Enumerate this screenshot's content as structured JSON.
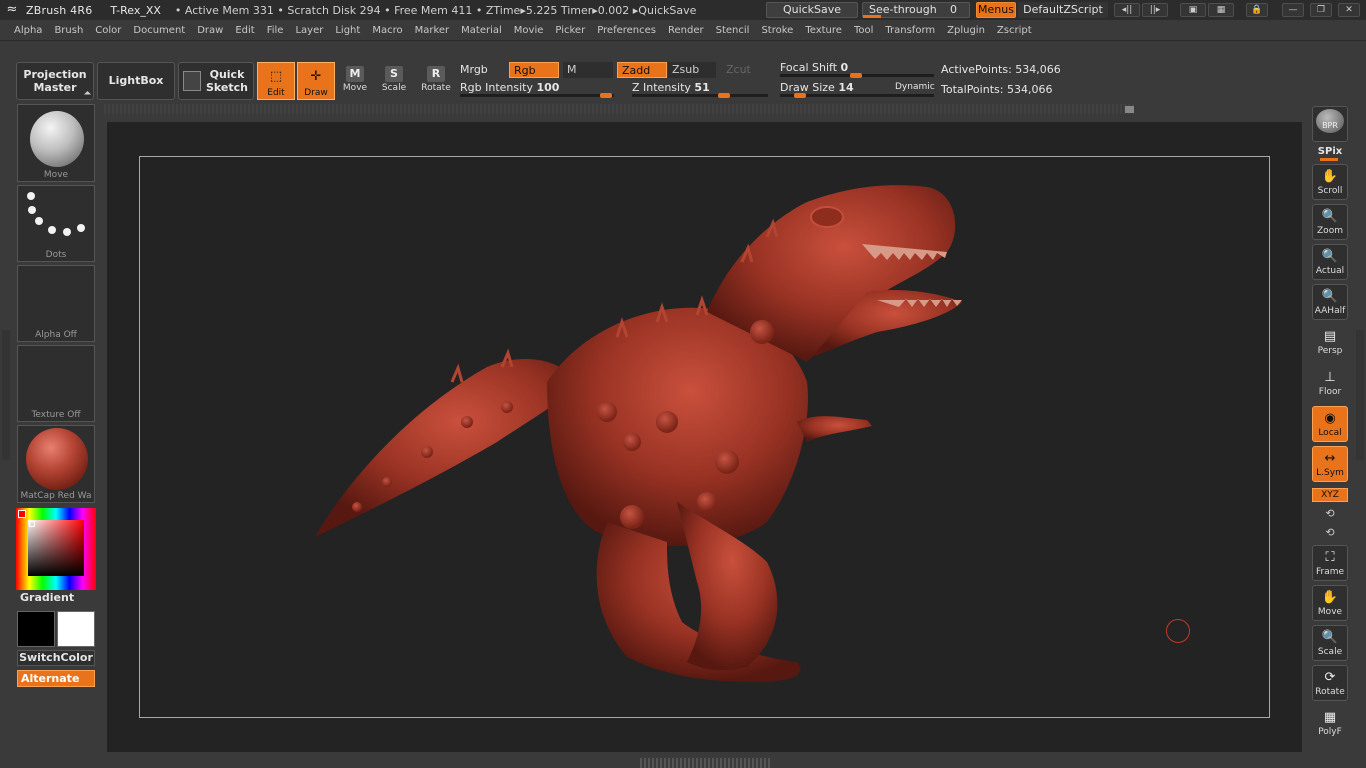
{
  "titlebar": {
    "app": "ZBrush 4R6",
    "file": "T-Rex_XX",
    "status": "• Active Mem 331 • Scratch Disk 294 • Free Mem 411 • ZTime▸5.225 Timer▸0.002 ▸QuickSave",
    "quicksave": "QuickSave",
    "seethrough_label": "See-through",
    "seethrough_value": "0",
    "menus": "Menus",
    "defaultzscript": "DefaultZScript"
  },
  "menubar": [
    "Alpha",
    "Brush",
    "Color",
    "Document",
    "Draw",
    "Edit",
    "File",
    "Layer",
    "Light",
    "Macro",
    "Marker",
    "Material",
    "Movie",
    "Picker",
    "Preferences",
    "Render",
    "Stencil",
    "Stroke",
    "Texture",
    "Tool",
    "Transform",
    "Zplugin",
    "Zscript"
  ],
  "shelf": {
    "projection_master_line1": "Projection",
    "projection_master_line2": "Master",
    "lightbox": "LightBox",
    "quick_sketch_line1": "Quick",
    "quick_sketch_line2": "Sketch",
    "tools": [
      {
        "label": "Edit",
        "glyph": "⬚",
        "active": true
      },
      {
        "label": "Draw",
        "glyph": "✛",
        "active": true
      },
      {
        "label": "Move",
        "glyph": "M",
        "active": false
      },
      {
        "label": "Scale",
        "glyph": "S",
        "active": false
      },
      {
        "label": "Rotate",
        "glyph": "R",
        "active": false
      }
    ],
    "mrgb": "Mrgb",
    "rgb": "Rgb",
    "m": "M",
    "rgb_intensity_label": "Rgb Intensity",
    "rgb_intensity_value": "100",
    "zadd": "Zadd",
    "zsub": "Zsub",
    "zcut": "Zcut",
    "z_intensity_label": "Z Intensity",
    "z_intensity_value": "51",
    "focal_shift_label": "Focal Shift",
    "focal_shift_value": "0",
    "draw_size_label": "Draw Size",
    "draw_size_value": "14",
    "dynamic": "Dynamic",
    "active_points_label": "ActivePoints:",
    "active_points_value": "534,066",
    "total_points_label": "TotalPoints:",
    "total_points_value": "534,066"
  },
  "lefttray": {
    "brush_caption": "Move",
    "stroke_caption": "Dots",
    "alpha_caption": "Alpha  Off",
    "texture_caption": "Texture  Off",
    "material_caption": "MatCap  Red  Wa",
    "gradient": "Gradient",
    "switchcolor": "SwitchColor",
    "alternate": "Alternate"
  },
  "righttray": {
    "bpr": "BPR",
    "spix": "SPix",
    "buttons": [
      {
        "label": "Scroll",
        "glyph": "✋"
      },
      {
        "label": "Zoom",
        "glyph": "🔍"
      },
      {
        "label": "Actual",
        "glyph": "🔍"
      },
      {
        "label": "AAHalf",
        "glyph": "🔍"
      },
      {
        "label": "Persp",
        "glyph": "▤"
      },
      {
        "label": "Floor",
        "glyph": "⊥"
      },
      {
        "label": "Local",
        "glyph": "◉"
      },
      {
        "label": "L.Sym",
        "glyph": "↔"
      }
    ],
    "xyz": "XYZ",
    "lower_buttons": [
      {
        "label": "Frame",
        "glyph": "⛶"
      },
      {
        "label": "Move",
        "glyph": "✋"
      },
      {
        "label": "Scale",
        "glyph": "🔍"
      },
      {
        "label": "Rotate",
        "glyph": "⟳"
      },
      {
        "label": "PolyF",
        "glyph": "▦"
      }
    ]
  },
  "colors": {
    "accent": "#e8731a",
    "model": "#a8392a",
    "canvas": "#232323"
  }
}
